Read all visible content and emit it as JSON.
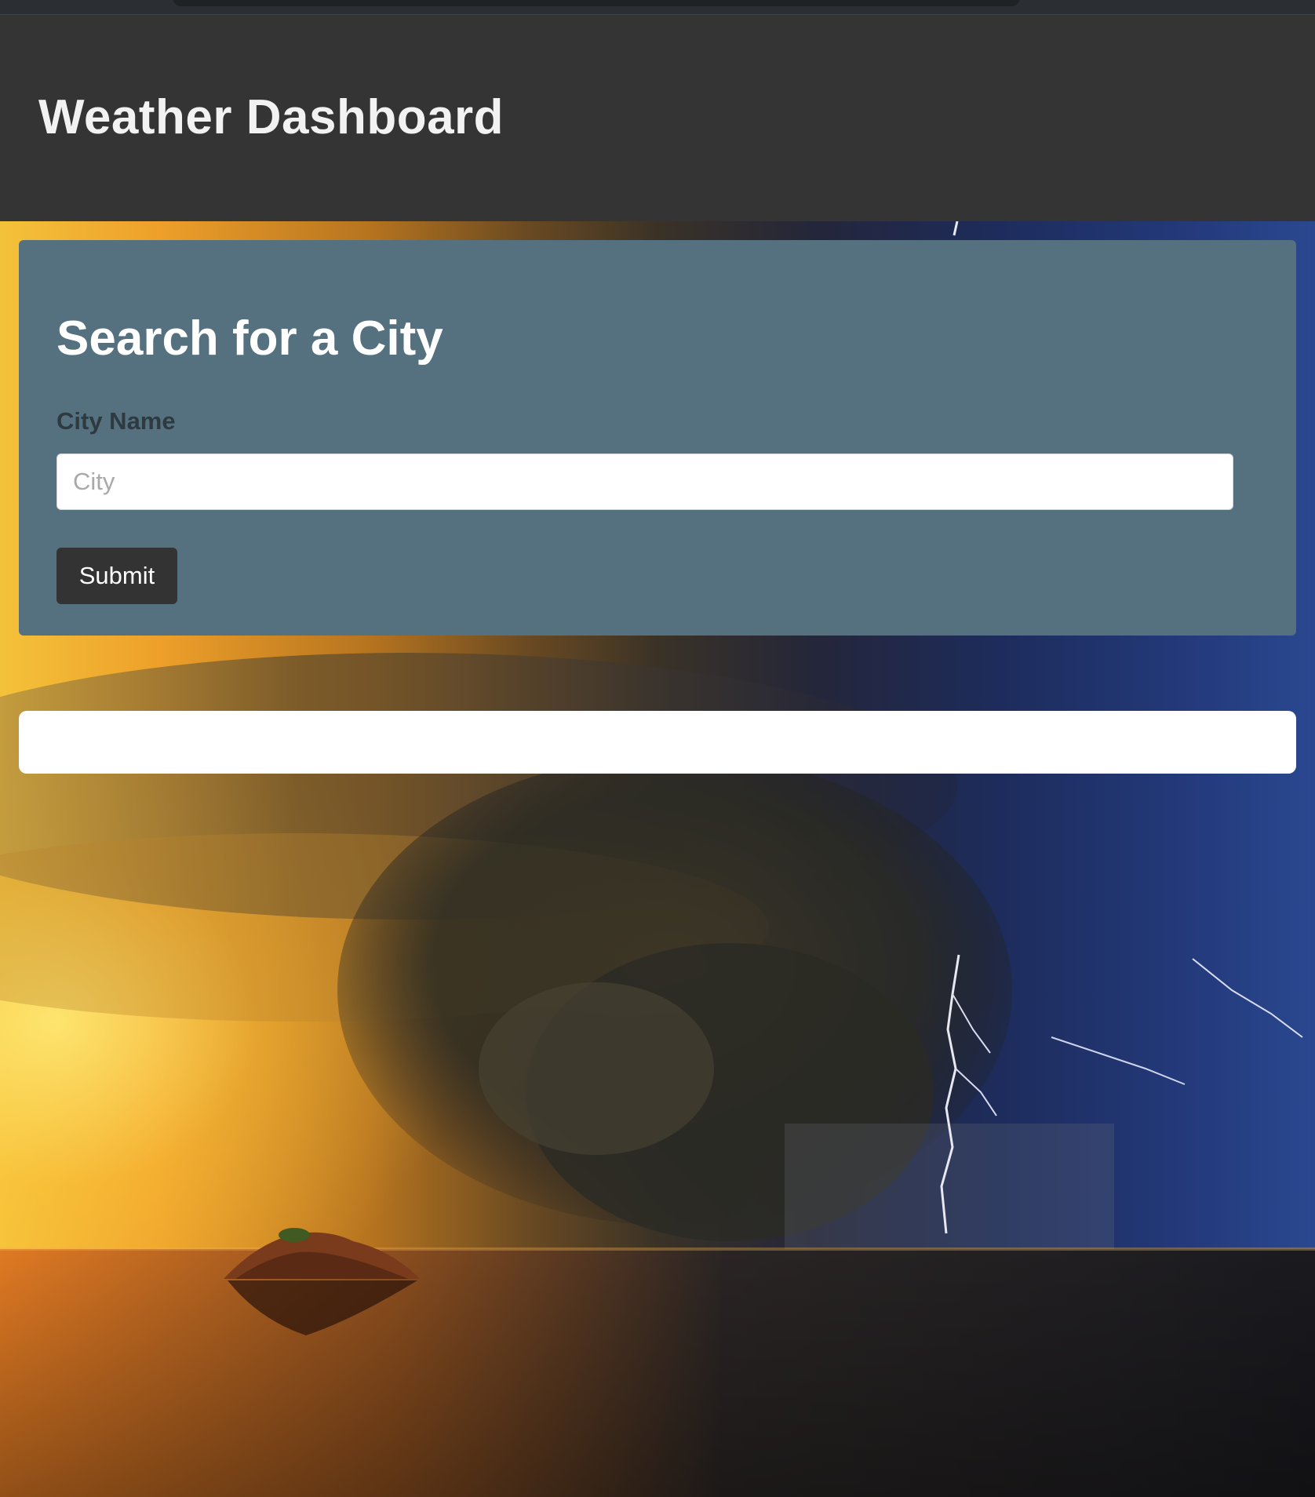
{
  "header": {
    "title": "Weather Dashboard"
  },
  "search": {
    "heading": "Search for a City",
    "field_label": "City Name",
    "placeholder": "City",
    "value": "",
    "submit_label": "Submit"
  },
  "results": {
    "content": ""
  },
  "colors": {
    "header_bg": "#343434",
    "card_bg": "#55717f",
    "button_bg": "#333333",
    "input_bg": "#ffffff"
  },
  "background": {
    "description_icon": "stormy-sea-sunset-background"
  }
}
